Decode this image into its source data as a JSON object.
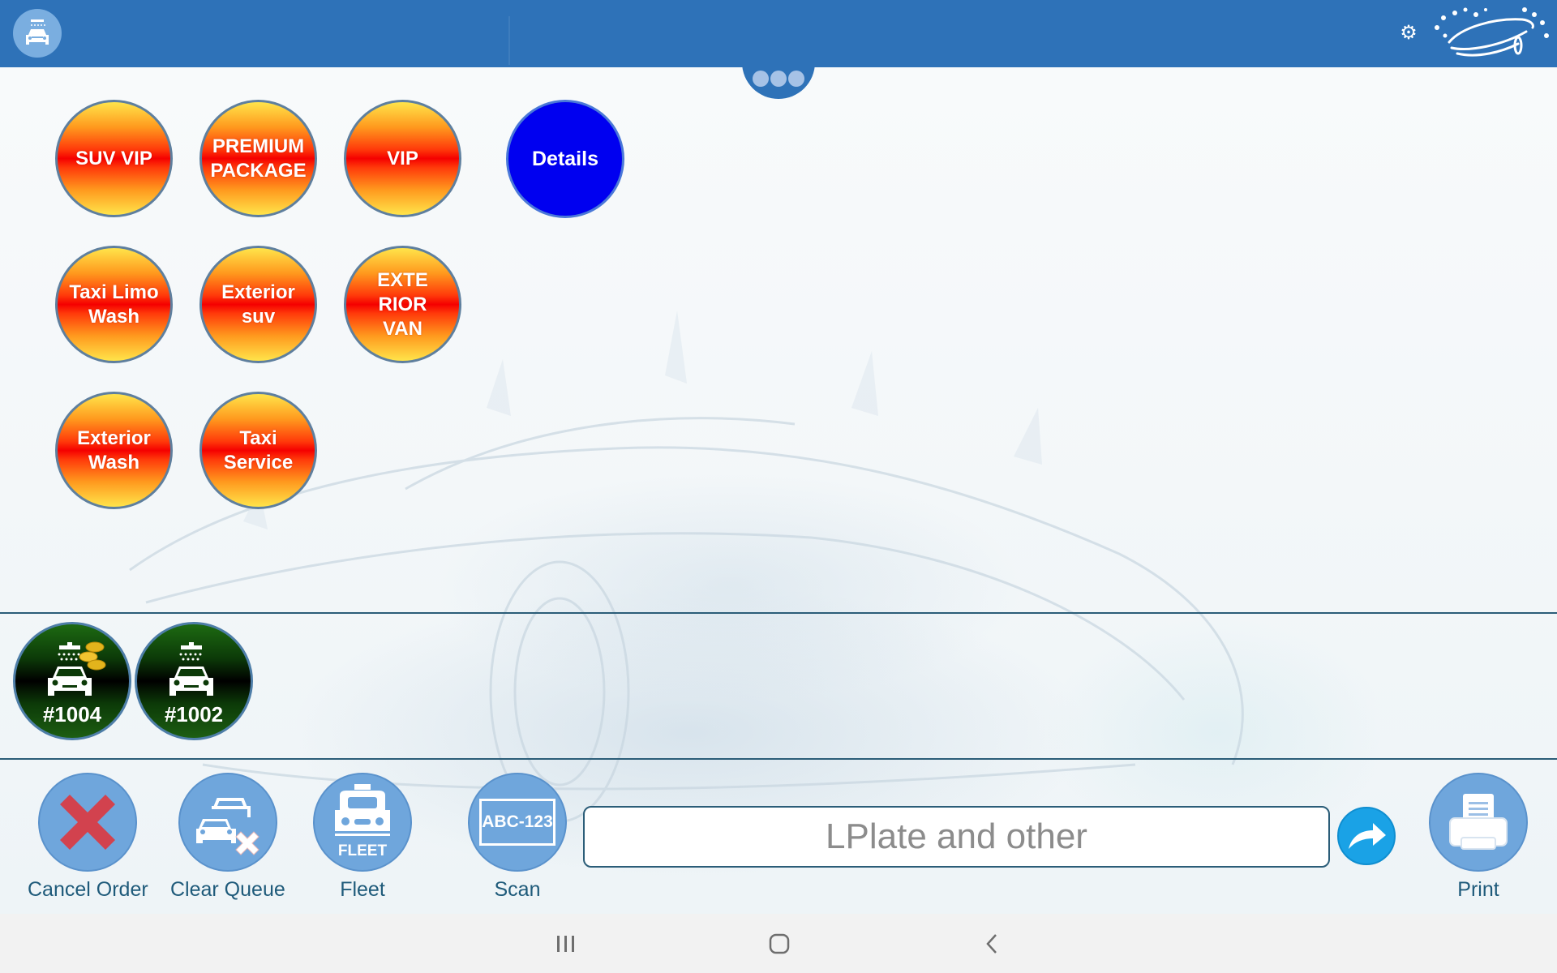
{
  "header": {
    "app_logo_icon": "car-wash-icon",
    "settings_icon": "gear-icon",
    "brand_logo_icon": "car-splash-logo",
    "handle_icon": "more-dots-icon"
  },
  "services": [
    {
      "label": "SUV VIP"
    },
    {
      "label": "PREMIUM\nPACKAGE"
    },
    {
      "label": "VIP"
    },
    {
      "label": "Taxi Limo\nWash"
    },
    {
      "label": "Exterior\nsuv"
    },
    {
      "label": "EXTE\nRIOR\nVAN"
    },
    {
      "label": "Exterior\nWash"
    },
    {
      "label": "Taxi\nService"
    }
  ],
  "details_button": {
    "label": "Details"
  },
  "queue": [
    {
      "number": "#1004",
      "icon": "car-wash-coins-icon"
    },
    {
      "number": "#1002",
      "icon": "car-wash-icon"
    }
  ],
  "toolbar": {
    "cancel_order": "Cancel Order",
    "clear_queue": "Clear Queue",
    "fleet": "Fleet",
    "fleet_badge": "FLEET",
    "scan": "Scan",
    "scan_plate": "ABC-123",
    "plate_placeholder": "LPlate and other",
    "plate_value": "",
    "print": "Print"
  },
  "colors": {
    "header": "#2e72b8",
    "details": "#0000f0",
    "toolbar_icon": "#6fa6dc",
    "cancel_x": "#d2424e",
    "go_button": "#1aa2e6",
    "divider": "#2b5d78"
  },
  "system_nav": {
    "recents_icon": "recents-icon",
    "home_icon": "home-icon",
    "back_icon": "back-icon"
  }
}
